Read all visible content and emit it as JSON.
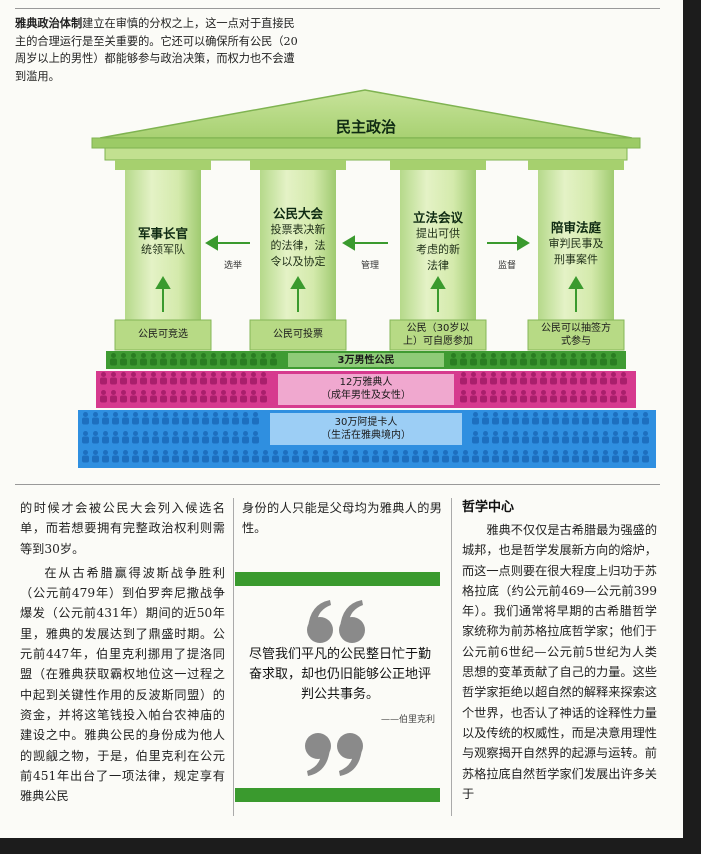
{
  "intro": {
    "bold": "雅典政治体制",
    "text": "建立在审慎的分权之上，这一点对于直接民主的合理运行是至关重要的。它还可以确保所有公民（20周岁以上的男性）都能够参与政治决策，而权力也不会遭到滥用。"
  },
  "diagram": {
    "roof_title": "民主政治",
    "pillars": [
      {
        "title": "军事长官",
        "sub": [
          "统领军队"
        ],
        "base": [
          "公民可竞选"
        ]
      },
      {
        "title": "公民大会",
        "sub": [
          "投票表决新",
          "的法律，法",
          "令以及协定"
        ],
        "base": [
          "公民可投票"
        ]
      },
      {
        "title": "立法会议",
        "sub": [
          "提出可供",
          "考虑的新",
          "法律"
        ],
        "base": [
          "公民（30岁以",
          "上）可自愿参加"
        ]
      },
      {
        "title": "陪审法庭",
        "sub": [
          "审判民事及",
          "刑事案件"
        ],
        "base": [
          "公民可以抽签方",
          "式参与"
        ]
      }
    ],
    "arrows": [
      "选举",
      "管理",
      "监督"
    ],
    "tiers": [
      {
        "lines": [
          "3万男性公民"
        ]
      },
      {
        "lines": [
          "12万雅典人",
          "（成年男性及女性）"
        ]
      },
      {
        "lines": [
          "30万阿提卡人",
          "（生活在雅典境内）"
        ]
      }
    ],
    "colors": {
      "green": "#3f9b33",
      "pink": "#d63a8e",
      "blue": "#2f8fe0",
      "pillar": "#cfe6a6"
    }
  },
  "col1": {
    "p1": "的时候才会被公民大会列入候选名单，而若想要拥有完整政治权利则需等到30岁。",
    "p2": "在从古希腊赢得波斯战争胜利（公元前479年）到伯罗奔尼撒战争爆发（公元前431年）期间的近50年里，雅典的发展达到了鼎盛时期。公元前447年，伯里克利挪用了提洛同盟（在雅典获取霸权地位这一过程之中起到关键性作用的反波斯同盟）的资金，并将这笔钱投入帕台农神庙的建设之中。雅典公民的身份成为他人的觊觎之物，于是，伯里克利在公元前451年出台了一项法律，规定享有雅典公民"
  },
  "col2": {
    "p1": "身份的人只能是父母均为雅典人的男性。",
    "quote": "尽管我们平凡的公民整日忙于勤奋求取，却也仍旧能够公正地评判公共事务。",
    "author": "——伯里克利"
  },
  "col3": {
    "heading": "哲学中心",
    "p1": "雅典不仅仅是古希腊最为强盛的城邦，也是哲学发展新方向的熔炉，而这一点则要在很大程度上归功于苏格拉底（约公元前469—公元前399年）。我们通常将早期的古希腊哲学家统称为前苏格拉底哲学家；他们于公元前6世纪—公元前5世纪为人类思想的变革贡献了自己的力量。这些哲学家拒绝以超自然的解释来探索这个世界，也否认了神话的诠释性力量以及传统的权威性，而是决意用理性与观察揭开自然界的起源与运转。前苏格拉底自然哲学家们发展出许多关于"
  }
}
